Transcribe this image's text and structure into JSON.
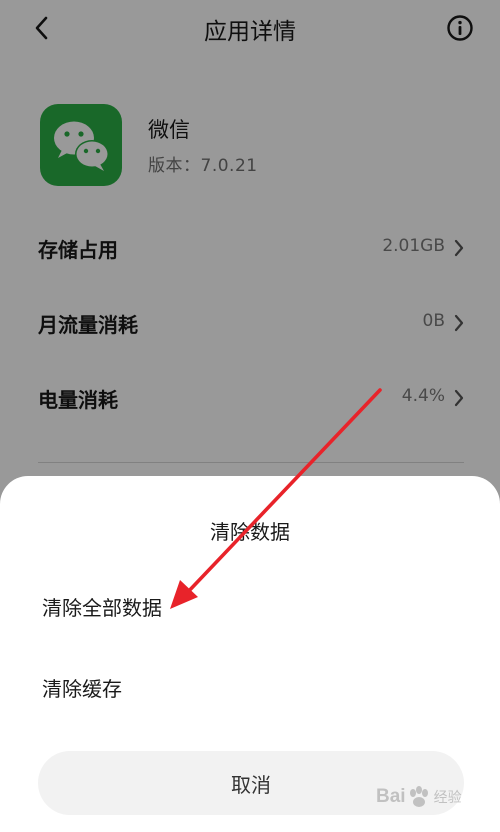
{
  "header": {
    "title": "应用详情",
    "back_icon": "chevron-left-icon",
    "info_icon": "info-circle-icon"
  },
  "app": {
    "name": "微信",
    "version": "版本：7.0.21",
    "icon": "wechat-logo-icon",
    "icon_color": "#2aae45"
  },
  "rows": [
    {
      "label": "存储占用",
      "value": "2.01GB"
    },
    {
      "label": "月流量消耗",
      "value": "0B"
    },
    {
      "label": "电量消耗",
      "value": "4.4%"
    }
  ],
  "sheet": {
    "title": "清除数据",
    "options": [
      {
        "label": "清除全部数据"
      },
      {
        "label": "清除缓存"
      }
    ],
    "cancel_label": "取消"
  },
  "annotation": {
    "arrow_color": "#e8232a"
  },
  "watermark": {
    "text": "Bai",
    "suffix": "经验"
  }
}
